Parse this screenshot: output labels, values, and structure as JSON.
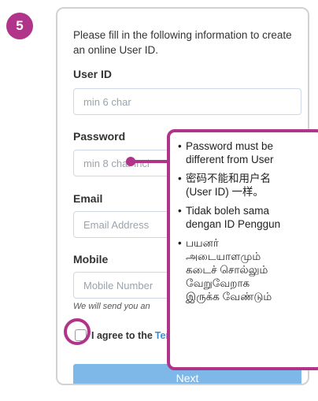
{
  "step": {
    "number": "5"
  },
  "form": {
    "intro": "Please fill in the following information to create an online User ID.",
    "user_id": {
      "label": "User ID",
      "placeholder": "min 6 char"
    },
    "password": {
      "label": "Password",
      "placeholder": "min 8 char incl"
    },
    "email": {
      "label": "Email",
      "placeholder": "Email Address"
    },
    "mobile": {
      "label": "Mobile",
      "placeholder": "Mobile Number",
      "helper": "We will send you an"
    },
    "agree": {
      "text": "I agree to the",
      "link": "Ter"
    },
    "next_label": "Next"
  },
  "callout": {
    "bullet": "•",
    "items": [
      "Password must be\ndifferent from User",
      "密码不能和用户名\n(User ID) 一样。",
      "Tidak boleh sama\ndengan ID Penggun",
      "பயனர்\nஅடையாளமும்\nகடைச் சொல்லும்\nவேறுவேறாக\nஇருக்க வேண்டும்"
    ]
  },
  "colors": {
    "accent": "#b0358a",
    "button": "#7db8e8",
    "link": "#3a8fd2"
  }
}
